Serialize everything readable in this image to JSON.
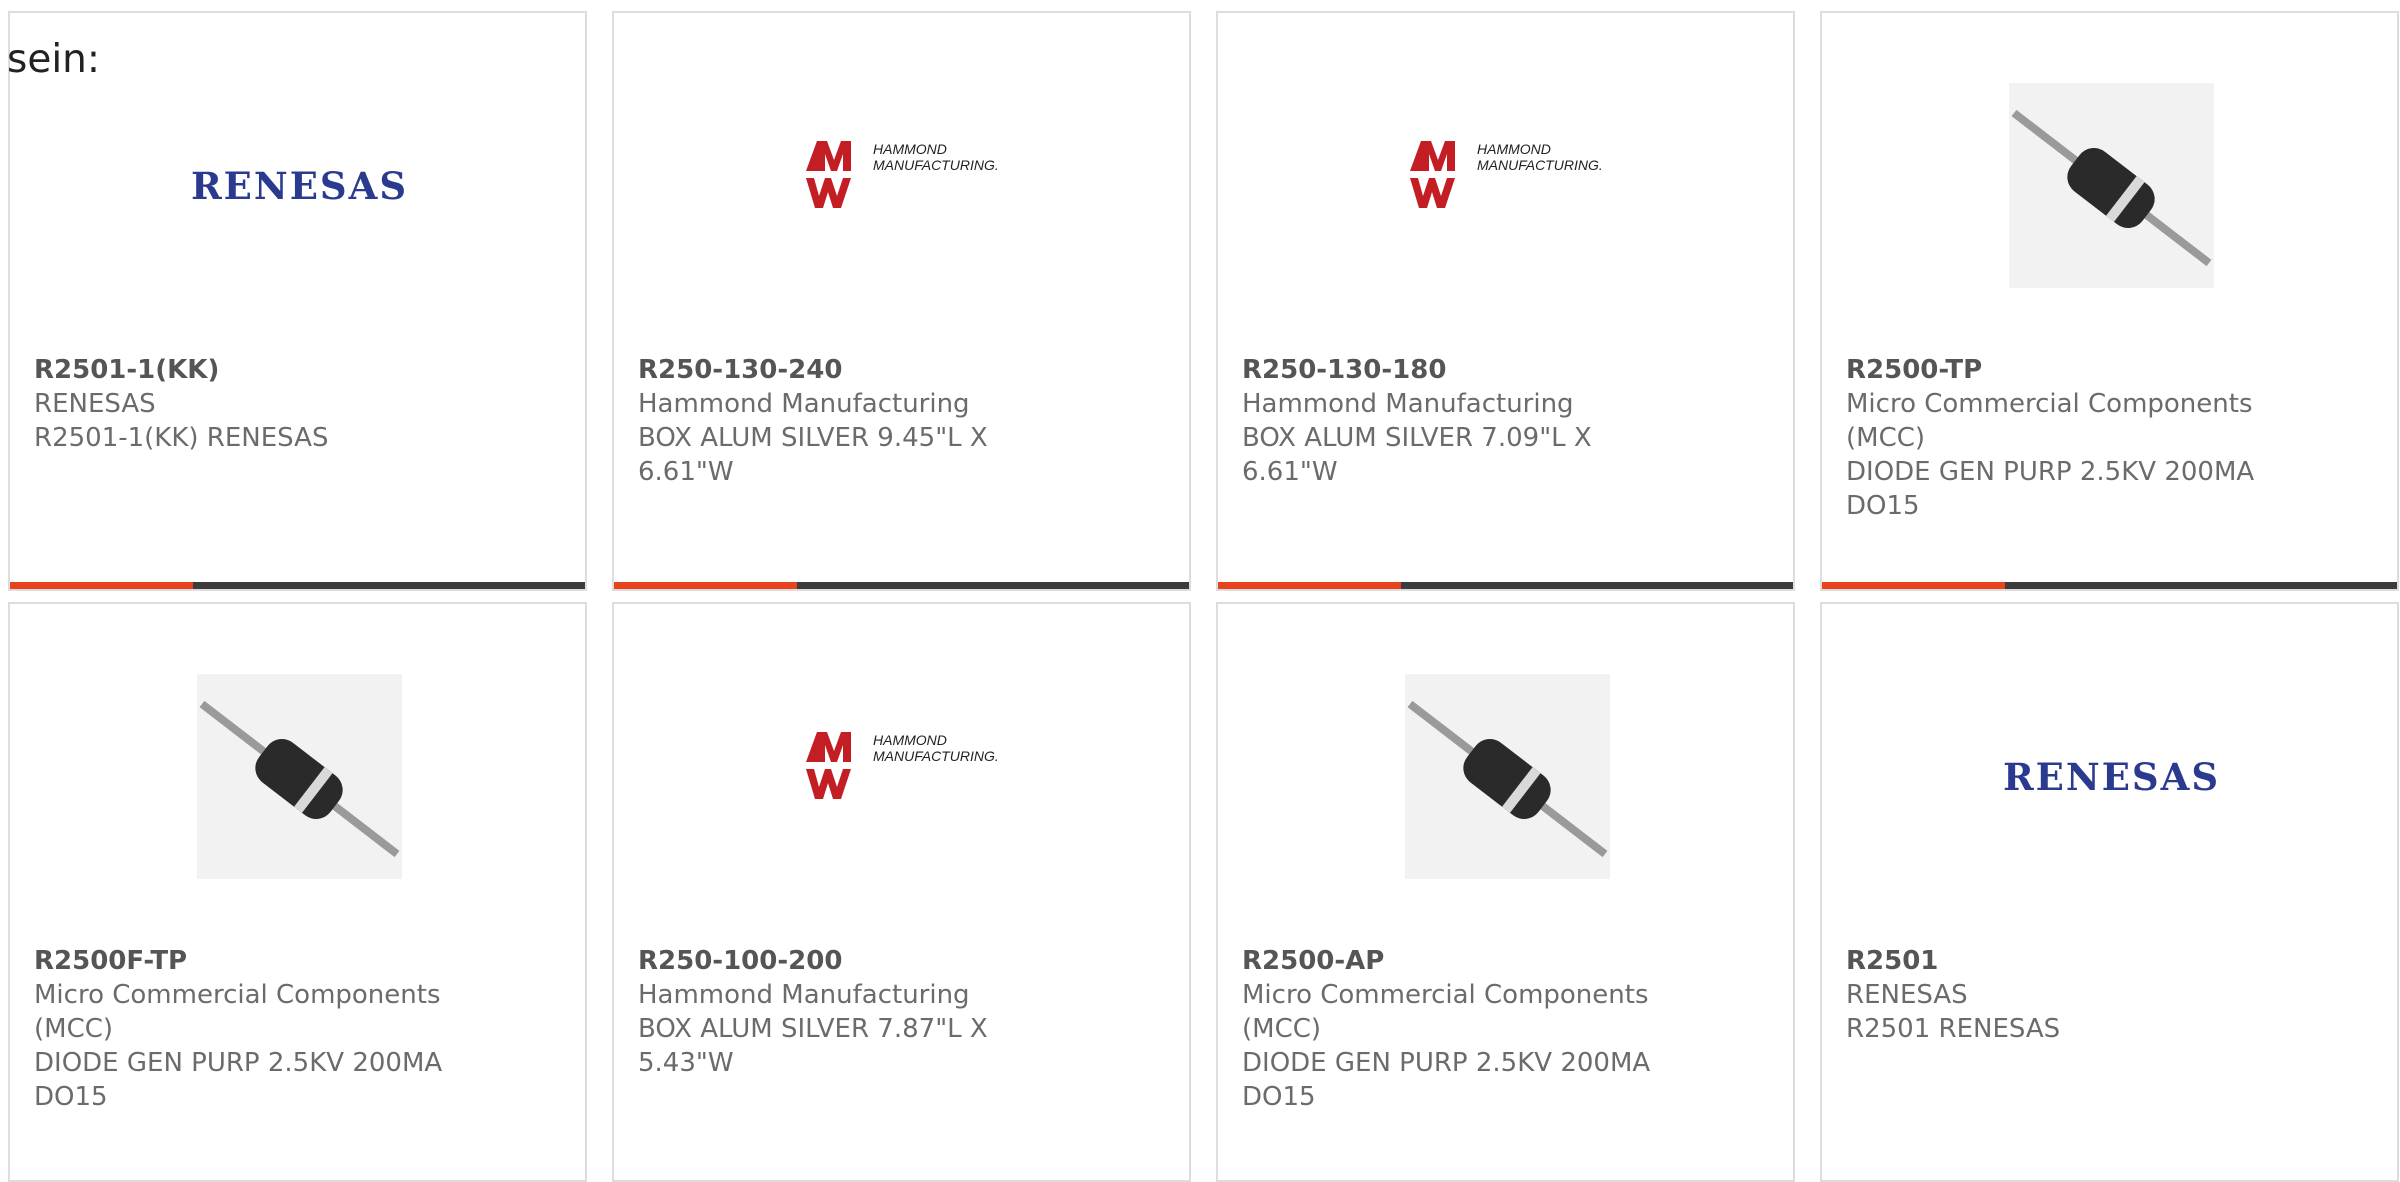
{
  "intro_text": "sein:",
  "colors": {
    "accent": "#e8431c",
    "bar": "#3c3c3c",
    "text": "#6b6b6b",
    "renesas": "#2a3a8f",
    "hammond": "#c21e24"
  },
  "products": [
    {
      "part_number": "R2501-1(KK)",
      "manufacturer": "RENESAS",
      "desc_lines": [
        "R2501-1(KK) RENESAS"
      ],
      "image": "renesas-logo",
      "logo_text": "RENESAS"
    },
    {
      "part_number": "R250-130-240",
      "manufacturer": "Hammond Manufacturing",
      "desc_lines": [
        "BOX ALUM SILVER 9.45\"L X",
        "6.61\"W"
      ],
      "image": "hammond-logo",
      "logo_text": [
        "HAMMOND",
        "MANUFACTURING."
      ]
    },
    {
      "part_number": "R250-130-180",
      "manufacturer": "Hammond Manufacturing",
      "desc_lines": [
        "BOX ALUM SILVER 7.09\"L X",
        "6.61\"W"
      ],
      "image": "hammond-logo",
      "logo_text": [
        "HAMMOND",
        "MANUFACTURING."
      ]
    },
    {
      "part_number": "R2500-TP",
      "manufacturer": "Micro Commercial Components (MCC)",
      "desc_lines": [
        "DIODE GEN PURP 2.5KV 200MA",
        "DO15"
      ],
      "image": "diode-photo",
      "diode_direction": "down"
    },
    {
      "part_number": "R2500F-TP",
      "manufacturer": "Micro Commercial Components (MCC)",
      "desc_lines": [
        "DIODE GEN PURP 2.5KV 200MA",
        "DO15"
      ],
      "image": "diode-photo",
      "diode_direction": "down"
    },
    {
      "part_number": "R250-100-200",
      "manufacturer": "Hammond Manufacturing",
      "desc_lines": [
        "BOX ALUM SILVER 7.87\"L X",
        "5.43\"W"
      ],
      "image": "hammond-logo",
      "logo_text": [
        "HAMMOND",
        "MANUFACTURING."
      ]
    },
    {
      "part_number": "R2500-AP",
      "manufacturer": "Micro Commercial Components (MCC)",
      "desc_lines": [
        "DIODE GEN PURP 2.5KV 200MA",
        "DO15"
      ],
      "image": "diode-photo",
      "diode_direction": "down"
    },
    {
      "part_number": "R2501",
      "manufacturer": "RENESAS",
      "desc_lines": [
        "R2501 RENESAS"
      ],
      "image": "renesas-logo",
      "logo_text": "RENESAS"
    }
  ]
}
